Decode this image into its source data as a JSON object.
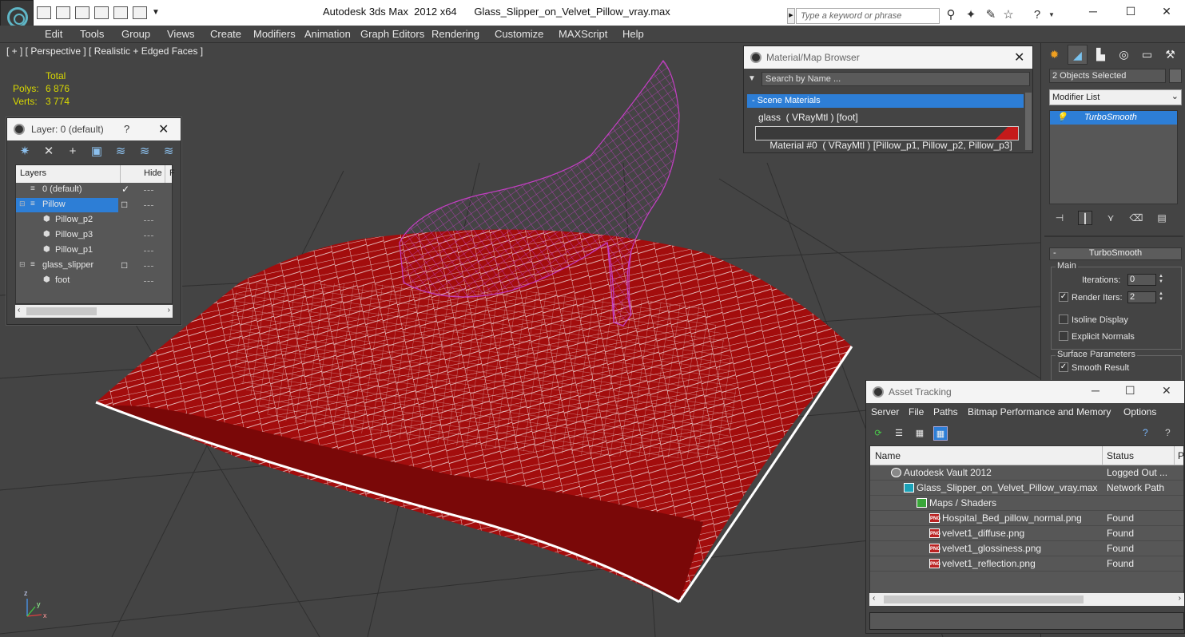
{
  "window": {
    "app_title": "Autodesk 3ds Max  2012 x64",
    "file_name": "Glass_Slipper_on_Velvet_Pillow_vray.max",
    "search_placeholder": "Type a keyword or phrase"
  },
  "menu": [
    "Edit",
    "Tools",
    "Group",
    "Views",
    "Create",
    "Modifiers",
    "Animation",
    "Graph Editors",
    "Rendering",
    "Customize",
    "MAXScript",
    "Help"
  ],
  "viewport": {
    "label": "[ + ] [ Perspective ] [ Realistic + Edged Faces ]",
    "stats_header": "Total",
    "polys_label": "Polys:",
    "polys_value": "6 876",
    "verts_label": "Verts:",
    "verts_value": "3 774",
    "axis_x": "x",
    "axis_y": "y",
    "axis_z": "z"
  },
  "layer_dialog": {
    "title": "Layer: 0 (default)",
    "help": "?",
    "col_layers": "Layers",
    "col_hide": "Hide",
    "col_freeze": "F",
    "rows": [
      {
        "name": "0 (default)",
        "indent": 0,
        "type": "layer",
        "check": "✓",
        "selected": false
      },
      {
        "name": "Pillow",
        "indent": 0,
        "type": "layer",
        "check": "□",
        "selected": true
      },
      {
        "name": "Pillow_p2",
        "indent": 1,
        "type": "object",
        "check": "",
        "selected": false
      },
      {
        "name": "Pillow_p3",
        "indent": 1,
        "type": "object",
        "check": "",
        "selected": false
      },
      {
        "name": "Pillow_p1",
        "indent": 1,
        "type": "object",
        "check": "",
        "selected": false
      },
      {
        "name": "glass_slipper",
        "indent": 0,
        "type": "layer",
        "check": "□",
        "selected": false
      },
      {
        "name": "foot",
        "indent": 1,
        "type": "object",
        "check": "",
        "selected": false
      }
    ]
  },
  "material_browser": {
    "title": "Material/Map Browser",
    "search_placeholder": "Search by Name ...",
    "group_label": "- Scene Materials",
    "items": [
      "glass  ( VRayMtl ) [foot]",
      "Material #0  ( VRayMtl ) [Pillow_p1, Pillow_p2, Pillow_p3]"
    ]
  },
  "command_panel": {
    "selection": "2 Objects Selected",
    "modifier_list": "Modifier List",
    "stack_item": "TurboSmooth",
    "rollout_title": "TurboSmooth",
    "main_group": "Main",
    "iterations_label": "Iterations:",
    "iterations_value": "0",
    "render_iters_label": "Render Iters:",
    "render_iters_value": "2",
    "render_iters_checked": true,
    "isoline_label": "Isoline Display",
    "isoline_checked": false,
    "explicit_normals_label": "Explicit Normals",
    "explicit_normals_checked": false,
    "surface_group": "Surface Parameters",
    "smooth_result_label": "Smooth Result",
    "smooth_result_checked": true
  },
  "asset_tracking": {
    "title": "Asset Tracking",
    "menu": [
      "Server",
      "File",
      "Paths",
      "Bitmap Performance and Memory",
      "Options"
    ],
    "col_name": "Name",
    "col_status": "Status",
    "col_extra": "P",
    "rows": [
      {
        "name": "Autodesk Vault 2012",
        "status": "Logged Out ...",
        "indent": 1,
        "icon": "vault"
      },
      {
        "name": "Glass_Slipper_on_Velvet_Pillow_vray.max",
        "status": "Network Path",
        "indent": 2,
        "icon": "max"
      },
      {
        "name": "Maps / Shaders",
        "status": "",
        "indent": 3,
        "icon": "maps"
      },
      {
        "name": "Hospital_Bed_pillow_normal.png",
        "status": "Found",
        "indent": 4,
        "icon": "png"
      },
      {
        "name": "velvet1_diffuse.png",
        "status": "Found",
        "indent": 4,
        "icon": "png"
      },
      {
        "name": "velvet1_glossiness.png",
        "status": "Found",
        "indent": 4,
        "icon": "png"
      },
      {
        "name": "velvet1_reflection.png",
        "status": "Found",
        "indent": 4,
        "icon": "png"
      }
    ]
  },
  "colors": {
    "selection_blue": "#2d7ed6",
    "pillow_red": "#a30d0d",
    "wire_white": "#ffffff",
    "slipper_magenta": "#c43fc4",
    "stats_yellow": "#d8d800"
  }
}
